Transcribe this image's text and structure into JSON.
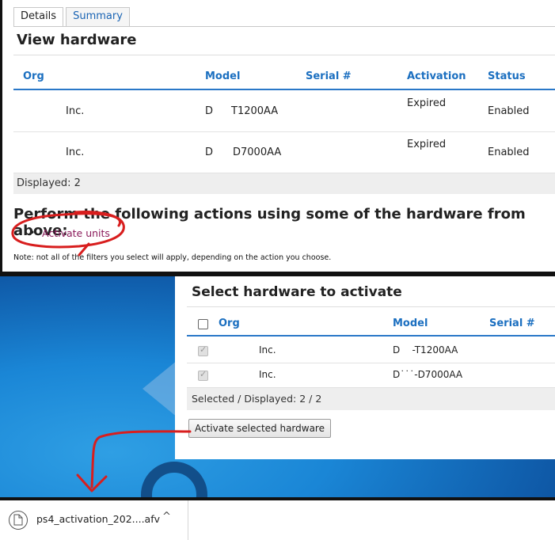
{
  "top": {
    "tabs": [
      "Details",
      "Summary"
    ],
    "title": "View hardware",
    "columns": [
      "Org",
      "Model",
      "Serial #",
      "Activation",
      "Status"
    ],
    "rows": [
      {
        "org": "Inc.",
        "model_prefix": "D",
        "model": "T1200AA",
        "activation": "Expired",
        "status": "Enabled"
      },
      {
        "org": "Inc.",
        "model_prefix": "D",
        "model": "D7000AA",
        "activation": "Expired",
        "status": "Enabled"
      }
    ],
    "displayed": "Displayed: 2",
    "actions_title": "Perform the following actions using some of the hardware from above:",
    "action_bullet": "•",
    "action_link": "Activate units",
    "note": "Note: not all of the filters you select will apply, depending on the action you choose."
  },
  "dialog": {
    "title": "Select hardware to activate",
    "columns": [
      "Org",
      "Model",
      "Serial #"
    ],
    "rows": [
      {
        "org": "Inc.",
        "model": "D    -T1200AA"
      },
      {
        "org": "Inc.",
        "model": "D˙˙˙-D7000AA"
      }
    ],
    "footer": "Selected / Displayed: 2 / 2",
    "button": "Activate selected hardware"
  },
  "download": {
    "filename": "ps4_activation_202....afv",
    "chevron": "^"
  },
  "colors": {
    "link": "#1a64b4",
    "header": "#1b6fc0",
    "action_link": "#8a1a5a",
    "annotation": "#d81e1e"
  }
}
